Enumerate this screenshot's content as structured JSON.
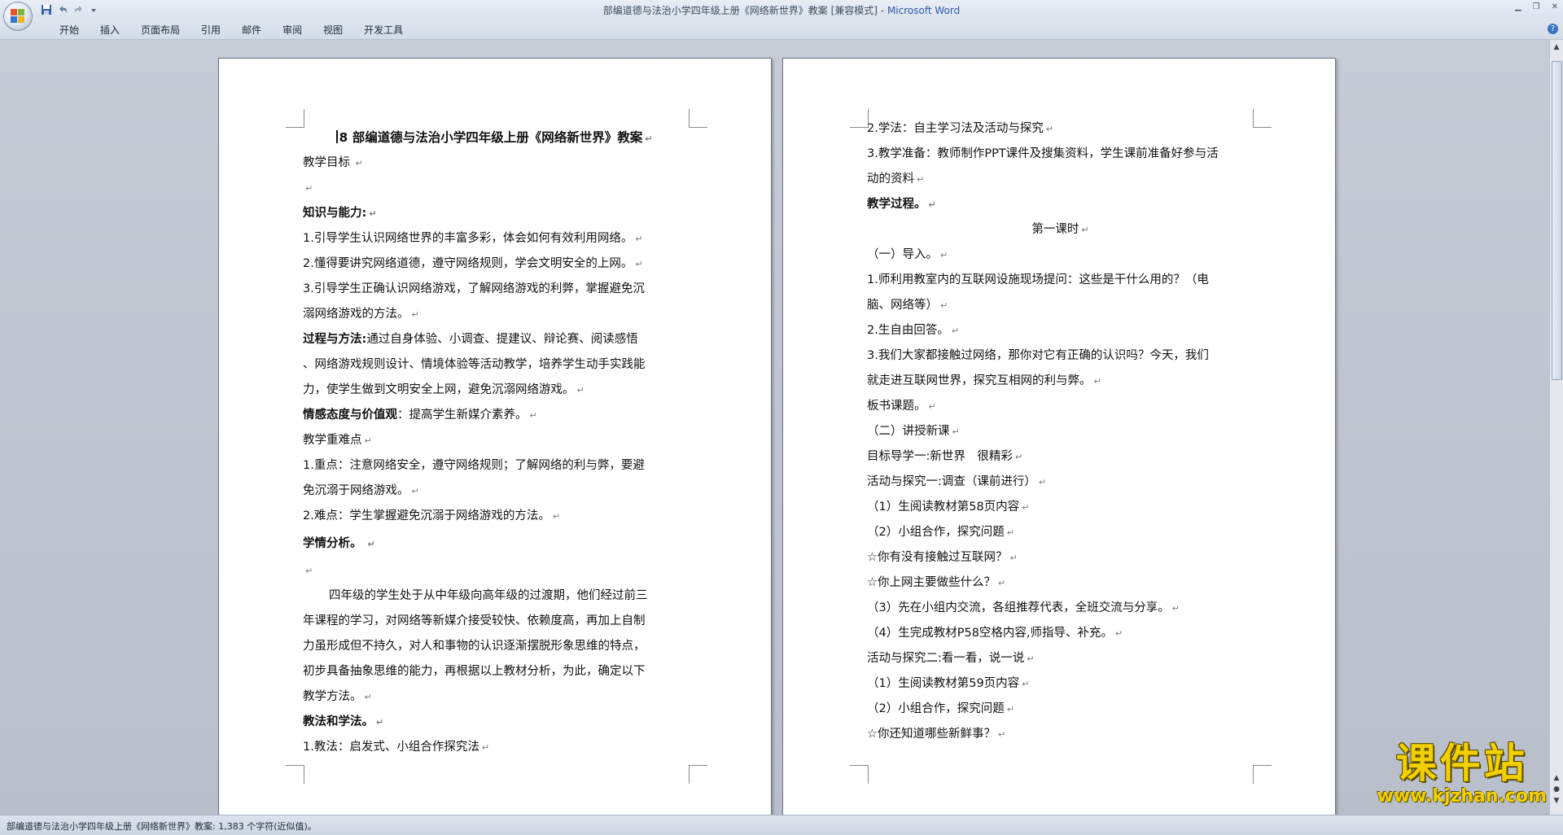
{
  "window": {
    "title_doc": "部编道德与法治小学四年级上册《网络新世界》教案 [兼容模式]",
    "title_sep": " - ",
    "title_app": "Microsoft Word"
  },
  "ribbon": {
    "tabs": [
      "开始",
      "插入",
      "页面布局",
      "引用",
      "邮件",
      "审阅",
      "视图",
      "开发工具"
    ]
  },
  "page1": {
    "title_num": "8",
    "title": "部编道德与法治小学四年级上册《网络新世界》教案",
    "lines": [
      "教学目标",
      "",
      "知识与能力:",
      "1.引导学生认识网络世界的丰富多彩，体会如何有效利用网络。",
      "2.懂得要讲究网络道德，遵守网络规则，学会文明安全的上网。",
      "3.引导学生正确认识网络游戏，了解网络游戏的利弊，掌握避免沉",
      "溺网络游戏的方法。",
      "过程与方法:",
      "通过自身体验、小调查、提建议、辩论赛、阅读感悟",
      "、网络游戏规则设计、情境体验等活动教学，培养学生动手实践能",
      "力，使学生做到文明安全上网，避免沉溺网络游戏。",
      "情感态度与价值观",
      "：提高学生新媒介素养。",
      "教学重难点",
      "1.重点：注意网络安全，遵守网络规则；了解网络的利与弊，要避",
      "免沉溺于网络游戏。",
      "2.难点：学生掌握避免沉溺于网络游戏的方法。",
      "学情分析。",
      "",
      "四年级的学生处于从中年级向高年级的过渡期，他们经过前三",
      "年课程的学习，对网络等新媒介接受较快、依赖度高，再加上自制",
      "力虽形成但不持久，对人和事物的认识逐渐摆脱形象思维的特点，",
      "初步具备抽象思维的能力，再根据以上教材分析，为此，确定以下",
      "教学方法。",
      "教法和学法。",
      "1.教法：启发式、小组合作探究法"
    ]
  },
  "page2": {
    "lines": [
      "2.学法：自主学习法及活动与探究",
      "3.教学准备：教师制作PPT课件及搜集资料，学生课前准备好参与活",
      "动的资料",
      "教学过程。",
      "第一课时",
      "（一）导入。",
      "1.师利用教室内的互联网设施现场提问：这些是干什么用的？（电",
      "脑、网络等）",
      "2.生自由回答。",
      "3.我们大家都接触过网络，那你对它有正确的认识吗？今天，我们",
      "就走进互联网世界，探究互相网的利与弊。",
      "板书课题。",
      "（二）讲授新课",
      "目标导学一:新世界　很精彩",
      "活动与探究一:调查（课前进行）",
      "（1）生阅读教材第58页内容",
      "（2）小组合作，探究问题",
      "☆你有没有接触过互联网？",
      "☆你上网主要做些什么？",
      "（3）先在小组内交流，各组推荐代表，全班交流与分享。",
      "（4）生完成教材P58空格内容,师指导、补充。",
      "活动与探究二:看一看，说一说",
      "（1）生阅读教材第59页内容",
      "（2）小组合作，探究问题",
      "☆你还知道哪些新鲜事？"
    ]
  },
  "status": {
    "text": "部编道德与法治小学四年级上册《网络新世界》教案: 1,383 个字符(近似值)。"
  },
  "watermark": {
    "big": "课件站",
    "small": "www.kjzhan.com"
  },
  "icons": {
    "office": "office-logo-icon",
    "save": "save-icon",
    "undo": "undo-icon",
    "redo": "redo-icon"
  }
}
